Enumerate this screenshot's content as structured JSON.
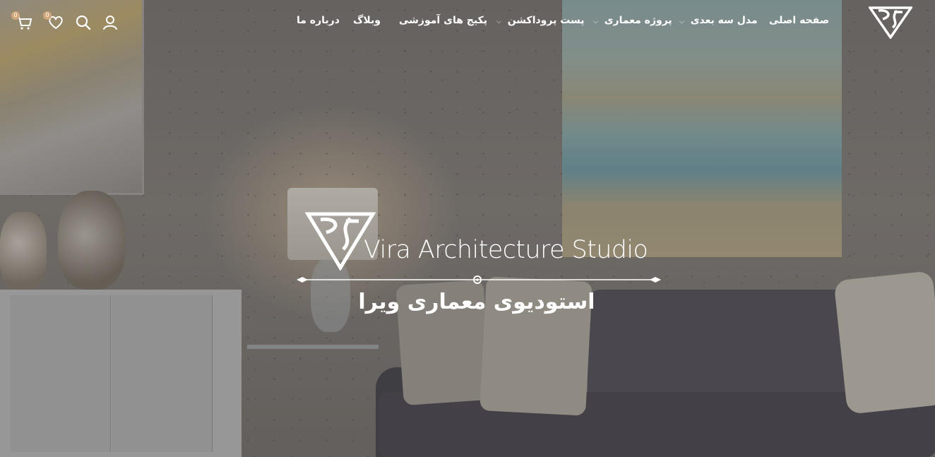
{
  "brand": {
    "name": "Vira Architecture Studio",
    "subtitle_fa": "استودیوی معماری ویرا"
  },
  "nav": {
    "items": [
      {
        "label": "صفحه اصلی",
        "has_dropdown": false
      },
      {
        "label": "مدل سه بعدی",
        "has_dropdown": true
      },
      {
        "label": "پروژه معماری",
        "has_dropdown": true
      },
      {
        "label": "پست پروداکشن",
        "has_dropdown": true
      },
      {
        "label": "پکیج های آموزشی",
        "has_dropdown": false
      },
      {
        "label": "وبلاگ",
        "has_dropdown": false
      },
      {
        "label": "درباره ما",
        "has_dropdown": false
      }
    ],
    "dropdown_glyph": "⌵"
  },
  "header_icons": {
    "account": "user-icon",
    "search": "search-icon",
    "wishlist": "heart-icon",
    "wishlist_count": "0",
    "cart": "cart-icon",
    "cart_count": "0"
  },
  "colors": {
    "text": "#ffffff",
    "badge": "#d2a77c"
  }
}
